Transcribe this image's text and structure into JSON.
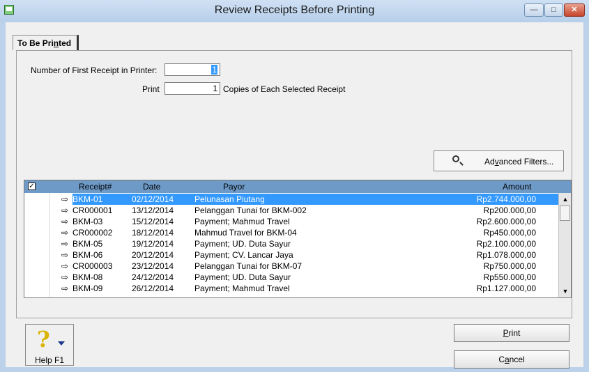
{
  "window": {
    "title": "Review Receipts Before Printing"
  },
  "tab": {
    "pre": "To Be Pri",
    "mnemonic": "n",
    "post": "ted"
  },
  "form": {
    "first_receipt_label": "Number of First Receipt in Printer:",
    "first_receipt_value": "1",
    "print_label": "Print",
    "print_value": "1",
    "copies_suffix": "Copies of Each Selected Receipt"
  },
  "advanced_filters": {
    "pre": "Ad",
    "mnemonic": "v",
    "post": "anced Filters..."
  },
  "grid": {
    "headers": {
      "receipt": "Receipt#",
      "date": "Date",
      "payor": "Payor",
      "amount": "Amount"
    },
    "rows": [
      {
        "receipt": "BKM-01",
        "date": "02/12/2014",
        "payor": "Pelunasan Piutang",
        "amount": "Rp2.744.000,00"
      },
      {
        "receipt": "CR000001",
        "date": "13/12/2014",
        "payor": "Pelanggan Tunai for BKM-002",
        "amount": "Rp200.000,00"
      },
      {
        "receipt": "BKM-03",
        "date": "15/12/2014",
        "payor": "Payment; Mahmud Travel",
        "amount": "Rp2.600.000,00"
      },
      {
        "receipt": "CR000002",
        "date": "18/12/2014",
        "payor": "Mahmud Travel for BKM-04",
        "amount": "Rp450.000,00"
      },
      {
        "receipt": "BKM-05",
        "date": "19/12/2014",
        "payor": "Payment; UD. Duta Sayur",
        "amount": "Rp2.100.000,00"
      },
      {
        "receipt": "BKM-06",
        "date": "20/12/2014",
        "payor": "Payment; CV. Lancar Jaya",
        "amount": "Rp1.078.000,00"
      },
      {
        "receipt": "CR000003",
        "date": "23/12/2014",
        "payor": "Pelanggan Tunai for BKM-07",
        "amount": "Rp750.000,00"
      },
      {
        "receipt": "BKM-08",
        "date": "24/12/2014",
        "payor": "Payment; UD. Duta Sayur",
        "amount": "Rp550.000,00"
      },
      {
        "receipt": "BKM-09",
        "date": "26/12/2014",
        "payor": "Payment; Mahmud Travel",
        "amount": "Rp1.127.000,00"
      }
    ],
    "selected_row": 0
  },
  "buttons": {
    "help_label": "Help F1",
    "print": {
      "mnemonic": "P",
      "post": "rint"
    },
    "cancel": {
      "pre": "C",
      "mnemonic": "a",
      "post": "ncel"
    }
  },
  "icons": {
    "app": "app-icon",
    "help": "question-mark-icon",
    "search": "magnifier-icon",
    "row_marker": "arrow-right-icon"
  },
  "colors": {
    "selection": "#3399ff",
    "grid_header": "#6e9ac8",
    "frame": "#bcd2ea"
  }
}
